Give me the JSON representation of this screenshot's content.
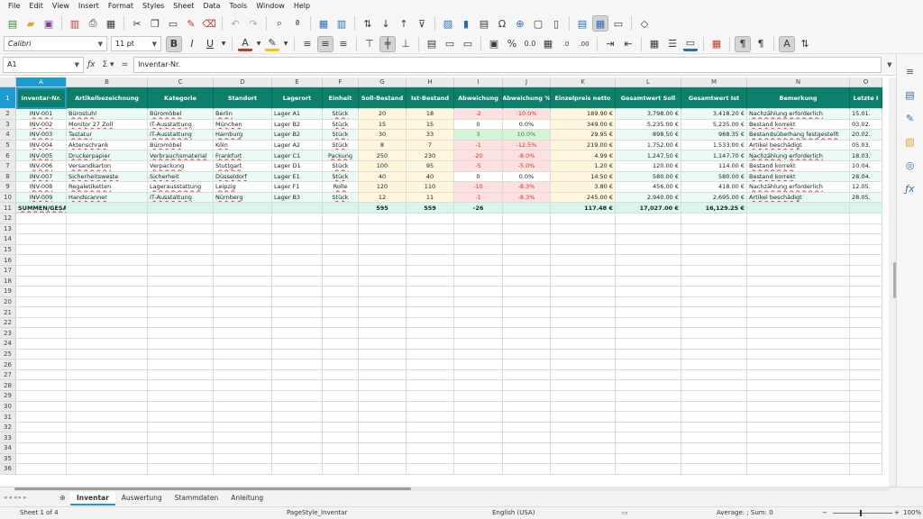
{
  "menu": [
    "File",
    "Edit",
    "View",
    "Insert",
    "Format",
    "Styles",
    "Sheet",
    "Data",
    "Tools",
    "Window",
    "Help"
  ],
  "toolbar2": {
    "font_name": "Calibri",
    "font_size": "11 pt"
  },
  "formula": {
    "cell_ref": "A1",
    "content": "Inventar-Nr."
  },
  "columns": [
    "A",
    "B",
    "C",
    "D",
    "E",
    "F",
    "G",
    "H",
    "I",
    "J",
    "K",
    "L",
    "M",
    "N",
    "O"
  ],
  "header": [
    "Inventar-Nr.",
    "Artikelbezeichnung",
    "Kategorie",
    "Standort",
    "Lagerort",
    "Einheit",
    "Soll-Bestand",
    "Ist-Bestand",
    "Abweichung",
    "Abweichung %",
    "Einzelpreis netto",
    "Gesamtwert Soll",
    "Gesamtwert Ist",
    "Bemerkung",
    "Letzte I"
  ],
  "rows": [
    [
      "INV-001",
      "Bürostuhl",
      "Büromöbel",
      "Berlin",
      "Lager A1",
      "Stück",
      "20",
      "18",
      "-2",
      "-10.0%",
      "189.90 €",
      "3,798.00 €",
      "3,418.20 €",
      "Nachzählung erforderlich",
      "15.01."
    ],
    [
      "INV-002",
      "Monitor 27 Zoll",
      "IT-Ausstattung",
      "München",
      "Lager B2",
      "Stück",
      "15",
      "15",
      "0",
      "0.0%",
      "349.00 €",
      "5,235.00 €",
      "5,235.00 €",
      "Bestand korrekt",
      "03.02."
    ],
    [
      "INV-003",
      "Tastatur",
      "IT-Ausstattung",
      "Hamburg",
      "Lager B2",
      "Stück",
      "30",
      "33",
      "3",
      "10.0%",
      "29.95 €",
      "898.50 €",
      "988.35 €",
      "Bestandsüberhang festgestellt",
      "20.02."
    ],
    [
      "INV-004",
      "Aktenschrank",
      "Büromöbel",
      "Köln",
      "Lager A2",
      "Stück",
      "8",
      "7",
      "-1",
      "-12.5%",
      "219.00 €",
      "1,752.00 €",
      "1,533.00 €",
      "Artikel beschädigt",
      "05.03."
    ],
    [
      "INV-005",
      "Druckerpapier",
      "Verbrauchsmaterial",
      "Frankfurt",
      "Lager C1",
      "Packung",
      "250",
      "230",
      "-20",
      "-8.0%",
      "4.99 €",
      "1,247.50 €",
      "1,147.70 €",
      "Nachzählung erforderlich",
      "18.03."
    ],
    [
      "INV-006",
      "Versandkarton",
      "Verpackung",
      "Stuttgart",
      "Lager D1",
      "Stück",
      "100",
      "95",
      "-5",
      "-5.0%",
      "1.20 €",
      "120.00 €",
      "114.00 €",
      "Bestand korrekt",
      "10.04."
    ],
    [
      "INV-007",
      "Sicherheitsweste",
      "Sicherheit",
      "Düsseldorf",
      "Lager E1",
      "Stück",
      "40",
      "40",
      "0",
      "0.0%",
      "14.50 €",
      "580.00 €",
      "580.00 €",
      "Bestand korrekt",
      "28.04."
    ],
    [
      "INV-008",
      "Regaletiketten",
      "Lagerausstattung",
      "Leipzig",
      "Lager F1",
      "Rolle",
      "120",
      "110",
      "-10",
      "-8.3%",
      "3.80 €",
      "456.00 €",
      "418.00 €",
      "Nachzählung erforderlich",
      "12.05."
    ],
    [
      "INV-009",
      "Handscanner",
      "IT-Ausstattung",
      "Nürnberg",
      "Lager B3",
      "Stück",
      "12",
      "11",
      "-1",
      "-8.3%",
      "245.00 €",
      "2,940.00 €",
      "2,695.00 €",
      "Artikel beschädigt",
      "28.05."
    ]
  ],
  "summary": [
    "SUMMEN/GESAMT",
    "",
    "",
    "",
    "",
    "",
    "595",
    "559",
    "-26",
    "",
    "117.48 €",
    "17,027.00 €",
    "16,129.25 €",
    "",
    ""
  ],
  "sheet_tabs": [
    "Inventar",
    "Auswertung",
    "Stammdaten",
    "Anleitung"
  ],
  "status": {
    "sheet": "Sheet 1 of 4",
    "page_style": "PageStyle_Inventar",
    "language": "English (USA)",
    "sum": "Average: ; Sum: 0",
    "zoom": "100%"
  },
  "colors": {
    "header_bg": "#0e7f6b",
    "selection": "#1e9bd1",
    "negative": "#d9302c",
    "positive_bg": "#d5f4d5"
  },
  "toolbar_icons": [
    "new-doc-icon",
    "open-icon",
    "save-icon",
    "export-pdf-icon",
    "print-icon",
    "print-preview-icon",
    "cut-icon",
    "copy-icon",
    "paste-icon",
    "clone-icon",
    "clear-icon",
    "undo-icon",
    "redo-icon",
    "find-replace-icon",
    "spelling-icon",
    "row-icon",
    "column-icon",
    "sort-icon",
    "sort-asc-icon",
    "sort-desc-icon",
    "autofilter-icon",
    "image-icon",
    "chart-icon",
    "pivot-icon",
    "special-char-icon",
    "hyperlink-icon",
    "comment-icon",
    "header-footer-icon",
    "define-print-area-icon",
    "freeze-icon",
    "split-icon",
    "show-draw-icon"
  ]
}
